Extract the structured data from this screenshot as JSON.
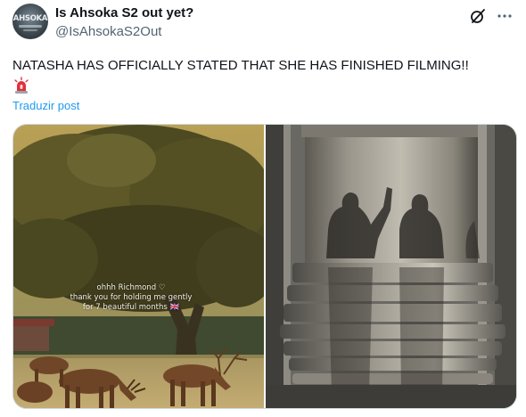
{
  "author": {
    "display_name": "Is Ahsoka S2 out yet?",
    "handle": "@IsAhsokaS2Out",
    "avatar_text": "AHSOKA"
  },
  "actions": {
    "grok_icon": "grok-icon",
    "more_icon": "more-icon"
  },
  "post": {
    "text": "NATASHA HAS OFFICIALLY STATED THAT SHE HAS FINISHED FILMING!!",
    "emoji": "siren-emoji",
    "translate_label": "Traduzir post"
  },
  "media": {
    "left_caption": {
      "line1": "ohhh Richmond ♡",
      "line2": "thank you for holding me gently",
      "line3": "for 7 beautiful months 🇬🇧"
    }
  },
  "colors": {
    "text": "#0f1419",
    "secondary_text": "#536471",
    "link": "#1d9bf0",
    "border": "#cfd9de"
  }
}
